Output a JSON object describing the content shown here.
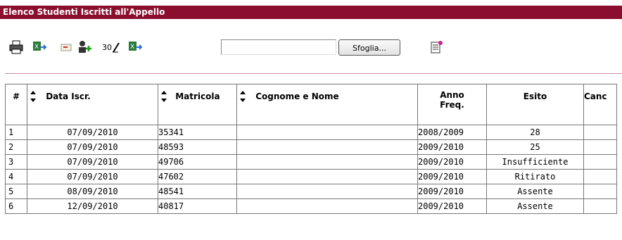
{
  "title": "Elenco Studenti Iscritti all'Appello",
  "toolbar": {
    "icons": [
      "printer-icon",
      "export-excel-icon",
      "email-icon",
      "add-user-icon",
      "grade-edit-icon",
      "import-excel-icon",
      "notes-icon"
    ],
    "grade_label": "30",
    "file_value": "",
    "browse_label": "Sfoglia..."
  },
  "table": {
    "headers": {
      "num": "#",
      "data_iscr": "Data Iscr.",
      "matricola": "Matricola",
      "cognome_nome": "Cognome e Nome",
      "anno_freq_1": "Anno",
      "anno_freq_2": "Freq.",
      "esito": "Esito",
      "canc": "Canc"
    },
    "rows": [
      {
        "num": "1",
        "data": "07/09/2010",
        "matricola": "35341",
        "nome": "",
        "anno": "2008/2009",
        "esito": "28"
      },
      {
        "num": "2",
        "data": "07/09/2010",
        "matricola": "48593",
        "nome": "",
        "anno": "2009/2010",
        "esito": "25"
      },
      {
        "num": "3",
        "data": "07/09/2010",
        "matricola": "49706",
        "nome": "",
        "anno": "2009/2010",
        "esito": "Insufficiente"
      },
      {
        "num": "4",
        "data": "07/09/2010",
        "matricola": "47602",
        "nome": "",
        "anno": "2009/2010",
        "esito": "Ritirato"
      },
      {
        "num": "5",
        "data": "08/09/2010",
        "matricola": "48541",
        "nome": "",
        "anno": "2009/2010",
        "esito": "Assente"
      },
      {
        "num": "6",
        "data": "12/09/2010",
        "matricola": "40817",
        "nome": "",
        "anno": "2009/2010",
        "esito": "Assente"
      }
    ]
  },
  "colors": {
    "title_bg": "#8b0e2e",
    "separator": "#c98a9a"
  }
}
